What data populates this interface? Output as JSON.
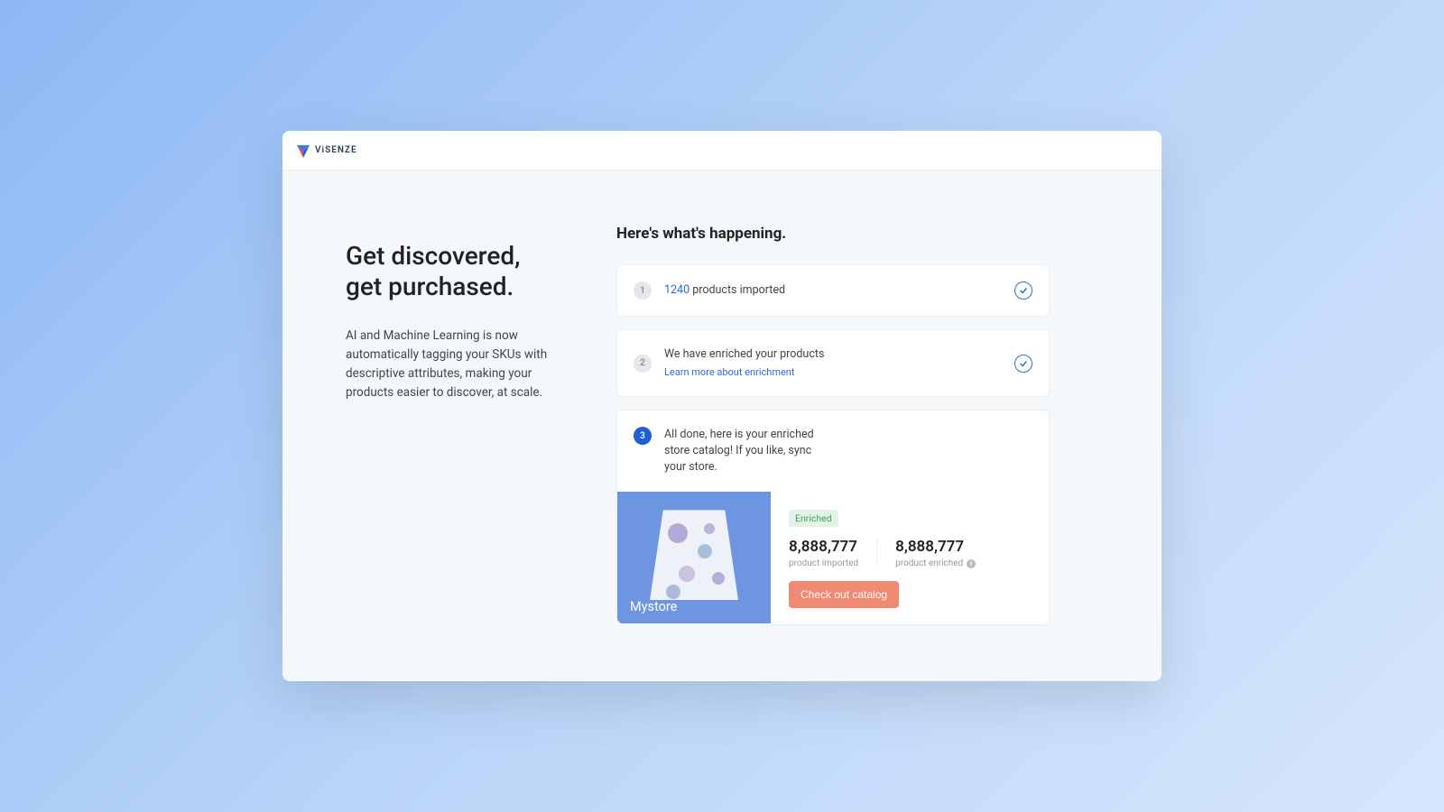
{
  "brand": "ViSENZE",
  "left": {
    "headline_l1": "Get discovered,",
    "headline_l2": "get purchased.",
    "subcopy": "AI and Machine Learning is now automatically tagging your SKUs with descriptive attributes, making your products easier to discover, at scale."
  },
  "panel_title": "Here's what's happening.",
  "steps": {
    "s1": {
      "num": "1",
      "count": "1240",
      "text": " products imported"
    },
    "s2": {
      "num": "2",
      "text": "We have enriched your products",
      "link": "Learn more about enrichment"
    },
    "s3": {
      "num": "3",
      "text": "All done, here is your enriched store catalog! If you like, sync your store."
    }
  },
  "catalog": {
    "store_name": "Mystore",
    "badge": "Enriched",
    "stat1_num": "8,888,777",
    "stat1_label": "product imported",
    "stat2_num": "8,888,777",
    "stat2_label": "product enriched",
    "cta": "Check out catalog"
  }
}
